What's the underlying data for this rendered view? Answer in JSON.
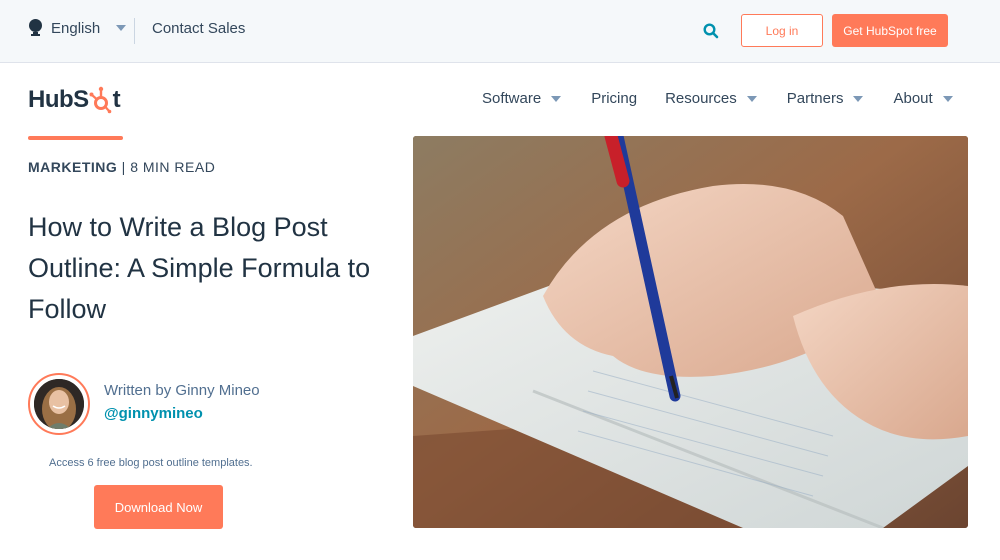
{
  "utility_bar": {
    "language": "English",
    "contact_sales": "Contact Sales",
    "login": "Log in",
    "cta": "Get HubSpot free",
    "icons": {
      "language": "globe-icon",
      "search": "search-icon"
    }
  },
  "brand": {
    "logo_text_a": "HubS",
    "logo_text_b": "t",
    "accent_color": "#ff7a59",
    "text_color": "#213343",
    "link_color": "#0091ae"
  },
  "nav": {
    "items": [
      {
        "label": "Software",
        "has_dropdown": true
      },
      {
        "label": "Pricing",
        "has_dropdown": false
      },
      {
        "label": "Resources",
        "has_dropdown": true
      },
      {
        "label": "Partners",
        "has_dropdown": true
      },
      {
        "label": "About",
        "has_dropdown": true
      }
    ]
  },
  "article": {
    "category": "MARKETING",
    "separator": " | ",
    "read_time": "8 MIN READ",
    "title": "How to Write a Blog Post Outline: A Simple Formula to Follow",
    "author": {
      "written_by": "Written by Ginny Mineo",
      "handle": "@ginnymineo"
    },
    "offer_text": "Access 6 free blog post outline templates.",
    "download_label": "Download Now",
    "hero_image": "hand writing in notebook with blue pen"
  }
}
